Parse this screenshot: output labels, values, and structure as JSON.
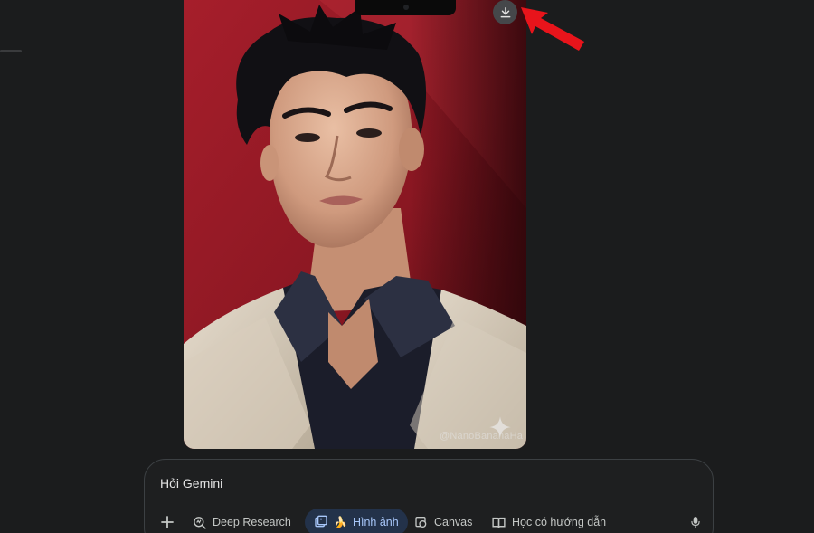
{
  "image": {
    "watermark_text": "@NanoBananaHa",
    "download_icon": "download-icon"
  },
  "composer": {
    "placeholder": "Hỏi Gemini",
    "tools": {
      "add_icon": "plus-icon",
      "deep_research": "Deep Research",
      "image_emoji": "🍌",
      "image_label": "Hình ảnh",
      "canvas": "Canvas",
      "guided_learning": "Học có hướng dẫn",
      "mic_icon": "mic-icon"
    }
  },
  "colors": {
    "background": "#1b1c1d",
    "active_tool": "#a8c7fa",
    "annotation_arrow": "#e8141b"
  }
}
